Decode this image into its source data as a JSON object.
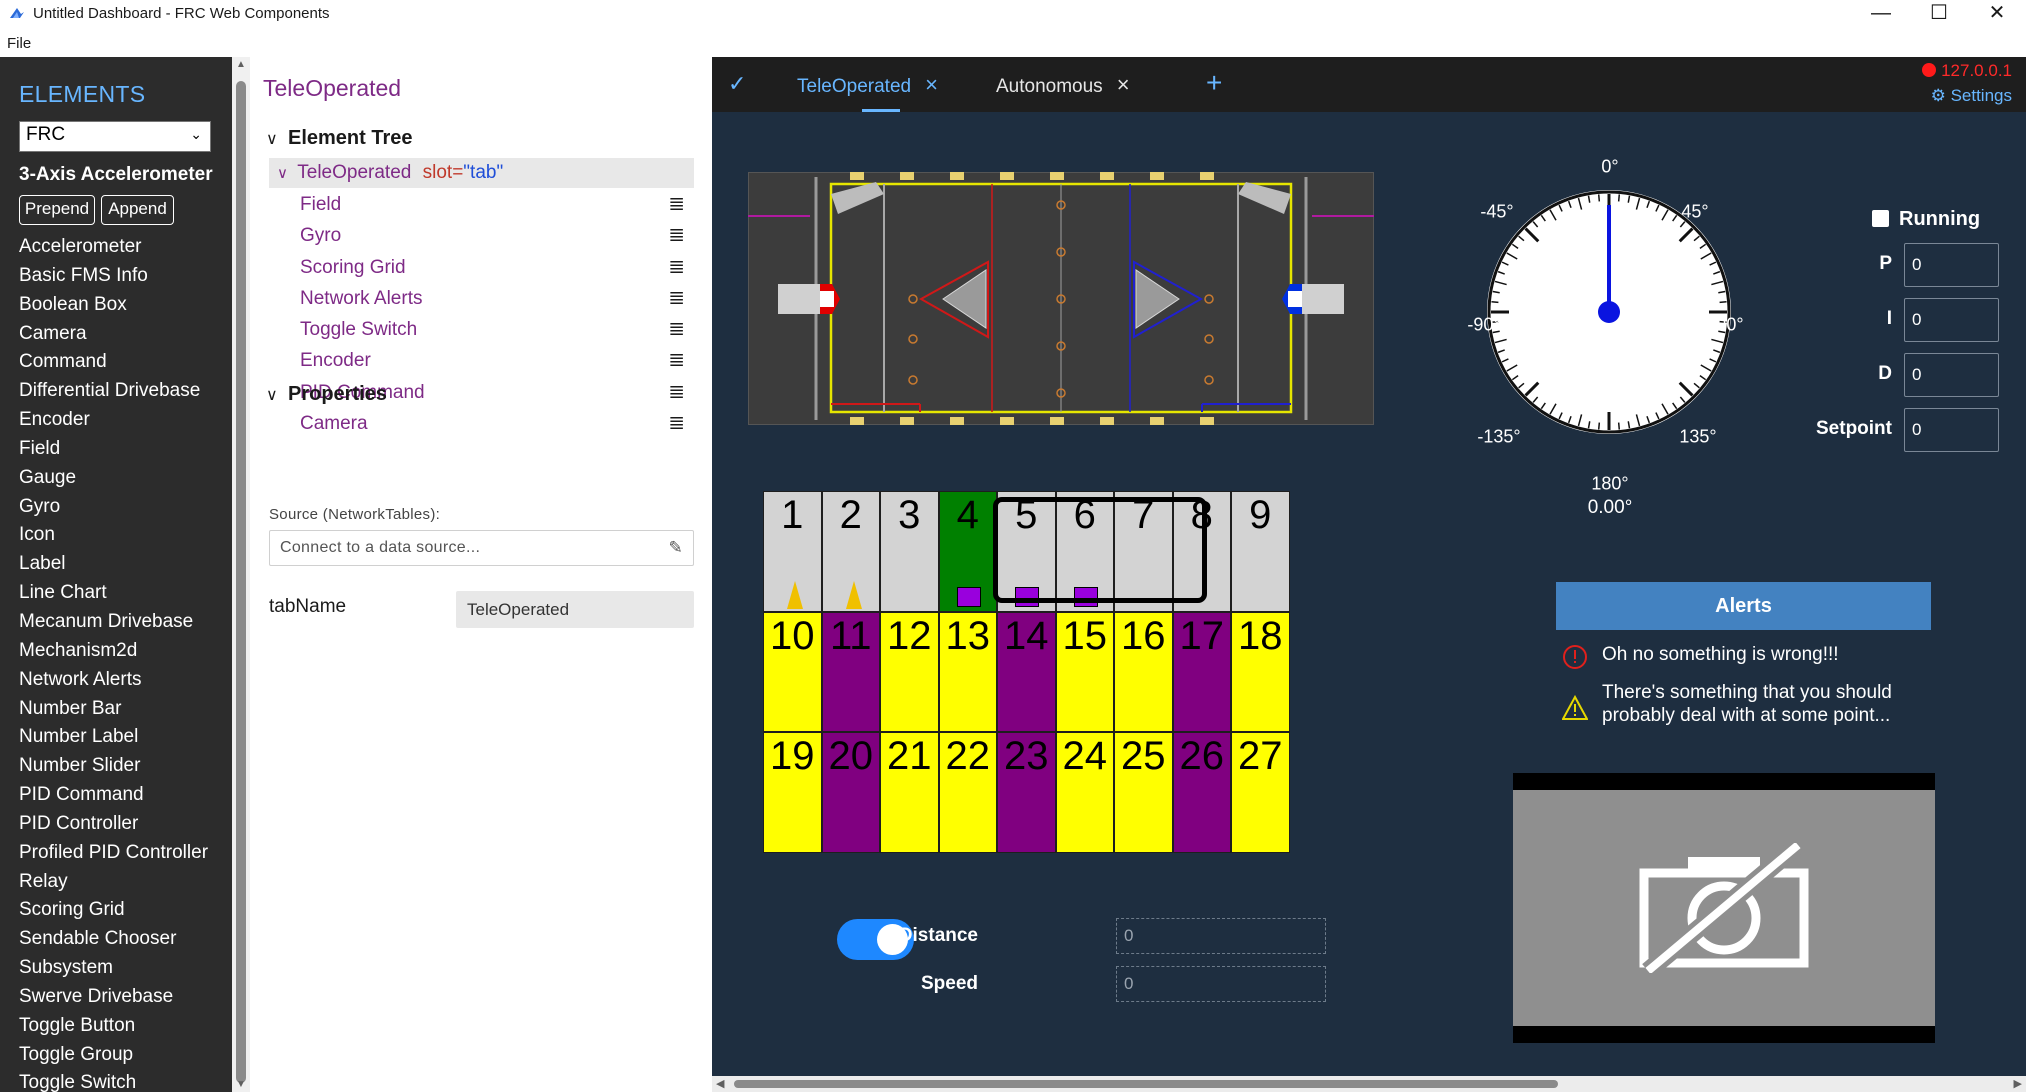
{
  "window": {
    "title": "Untitled Dashboard - FRC Web Components",
    "minimize": "—",
    "maximize": "☐",
    "close": "✕"
  },
  "menu": {
    "file": "File"
  },
  "sidebar": {
    "title": "ELEMENTS",
    "library": "FRC",
    "selected": "3-Axis Accelerometer",
    "prepend": "Prepend",
    "append": "Append",
    "items": [
      "Accelerometer",
      "Basic FMS Info",
      "Boolean Box",
      "Camera",
      "Command",
      "Differential Drivebase",
      "Encoder",
      "Field",
      "Gauge",
      "Gyro",
      "Icon",
      "Label",
      "Line Chart",
      "Mecanum Drivebase",
      "Mechanism2d",
      "Network Alerts",
      "Number Bar",
      "Number Label",
      "Number Slider",
      "PID Command",
      "PID Controller",
      "Profiled PID Controller",
      "Relay",
      "Scoring Grid",
      "Sendable Chooser",
      "Subsystem",
      "Swerve Drivebase",
      "Toggle Button",
      "Toggle Group",
      "Toggle Switch"
    ]
  },
  "editor": {
    "title": "TeleOperated",
    "element_tree_heading": "Element Tree",
    "tree_root": {
      "name": "TeleOperated",
      "attr": "slot=",
      "value": "\"tab\""
    },
    "tree_children": [
      "Field",
      "Gyro",
      "Scoring Grid",
      "Network Alerts",
      "Toggle Switch",
      "Encoder",
      "PID Command",
      "Camera"
    ],
    "properties_heading": "Properties",
    "source_label": "Source (NetworkTables):",
    "source_placeholder": "Connect to a data source...",
    "tabname_label": "tabName",
    "tabname_value": "TeleOperated"
  },
  "dashboard": {
    "tabs": [
      "TeleOperated",
      "Autonomous"
    ],
    "active_tab": "TeleOperated",
    "add_tab": "+",
    "connection": "127.0.0.1",
    "connection_color": "#ff1a1a",
    "settings": "Settings",
    "gyro": {
      "labels": {
        "deg0": "0°",
        "deg45": "45°",
        "degm45": "-45°",
        "deg90": "90°",
        "degm90": "-90°",
        "deg135": "135°",
        "degm135": "-135°",
        "deg180": "180°"
      },
      "value": "0.00°",
      "angle": 0
    },
    "pid": {
      "running_label": "Running",
      "running": false,
      "p_label": "P",
      "p": "0",
      "i_label": "I",
      "i": "0",
      "d_label": "D",
      "d": "0",
      "setpoint_label": "Setpoint",
      "setpoint": "0"
    },
    "scoring_grid": {
      "rows": [
        [
          "1",
          "2",
          "3",
          "4",
          "5",
          "6",
          "7",
          "8",
          "9"
        ],
        [
          "10",
          "11",
          "12",
          "13",
          "14",
          "15",
          "16",
          "17",
          "18"
        ],
        [
          "19",
          "20",
          "21",
          "22",
          "23",
          "24",
          "25",
          "26",
          "27"
        ]
      ],
      "colors": {
        "empty": "#d3d3d3",
        "cone_node": "#ffff00",
        "cube_node": "#800080",
        "filled": "#008000"
      }
    },
    "alerts": {
      "heading": "Alerts",
      "error": "Oh no something is wrong!!!",
      "warning": "There's something that you should probably deal with at some point..."
    },
    "toggle": {
      "on": true
    },
    "encoder": {
      "distance_label": "Distance",
      "distance": "0",
      "speed_label": "Speed",
      "speed": "0"
    }
  }
}
